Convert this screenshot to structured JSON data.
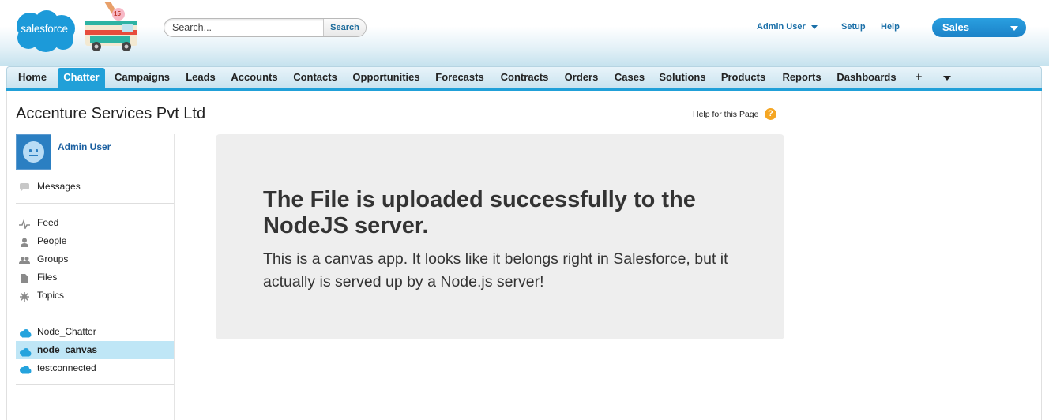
{
  "header": {
    "logo_text": "salesforce",
    "truck_badge": "15",
    "search": {
      "placeholder": "Search...",
      "button_label": "Search"
    },
    "user_menu_label": "Admin User",
    "setup_label": "Setup",
    "help_label": "Help",
    "app_selector_label": "Sales"
  },
  "tabs": [
    {
      "label": "Home"
    },
    {
      "label": "Chatter",
      "active": true
    },
    {
      "label": "Campaigns"
    },
    {
      "label": "Leads"
    },
    {
      "label": "Accounts"
    },
    {
      "label": "Contacts"
    },
    {
      "label": "Opportunities"
    },
    {
      "label": "Forecasts"
    },
    {
      "label": "Contracts"
    },
    {
      "label": "Orders"
    },
    {
      "label": "Cases"
    },
    {
      "label": "Solutions"
    },
    {
      "label": "Products"
    },
    {
      "label": "Reports"
    },
    {
      "label": "Dashboards"
    },
    {
      "label": "+"
    }
  ],
  "page": {
    "title": "Accenture Services Pvt Ltd",
    "help_text": "Help for this Page"
  },
  "sidebar": {
    "user_name": "Admin User",
    "messages_label": "Messages",
    "nav_items": [
      {
        "label": "Feed",
        "icon": "feed-icon"
      },
      {
        "label": "People",
        "icon": "person-icon"
      },
      {
        "label": "Groups",
        "icon": "groups-icon"
      },
      {
        "label": "Files",
        "icon": "file-icon"
      },
      {
        "label": "Topics",
        "icon": "topics-icon"
      }
    ],
    "apps": [
      {
        "label": "Node_Chatter",
        "icon": "cloud-icon"
      },
      {
        "label": "node_canvas",
        "icon": "cloud-icon",
        "selected": true
      },
      {
        "label": "testconnected",
        "icon": "cloud-icon"
      }
    ]
  },
  "canvas": {
    "heading": "The File is uploaded successfully to the NodeJS server.",
    "body": "This is a canvas app. It looks like it belongs right in Salesforce, but it actually is served up by a Node.js server!"
  },
  "colors": {
    "brand_blue": "#21a0d8",
    "app_selector": "#1b82c8",
    "link_blue": "#1a6fa8",
    "selected_row": "#bfe6f6",
    "help_orange": "#f5a623"
  }
}
